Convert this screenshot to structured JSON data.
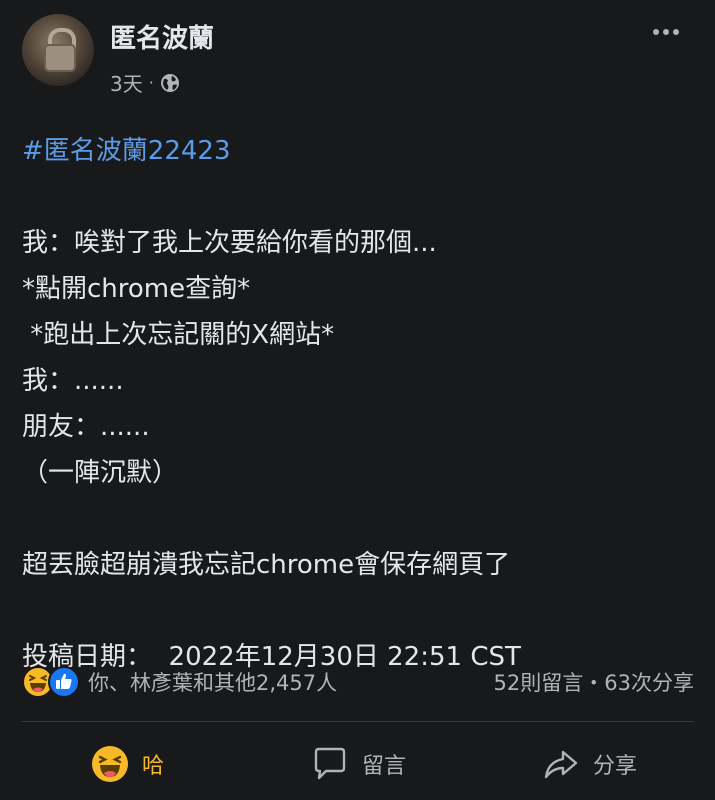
{
  "post": {
    "author": "匿名波蘭",
    "time": "3天",
    "separator": "·",
    "visibility_icon": "globe-icon",
    "more_icon": "more-horizontal-icon"
  },
  "content": {
    "hashtag": "#匿名波蘭22423",
    "lines": [
      "我：唉對了我上次要給你看的那個...",
      "*點開chrome查詢*",
      " *跑出上次忘記關的X網站*",
      "我：......",
      "朋友：......",
      "（一陣沉默）",
      "超丟臉超崩潰我忘記chrome會保存網頁了",
      "投稿日期：  2022年12月30日 22:51 CST"
    ]
  },
  "engagement": {
    "reaction_icons": [
      "haha-icon",
      "like-icon"
    ],
    "reactors": "你、林彥葉和其他2,457人",
    "comments_shares": "52則留言・63次分享"
  },
  "actions": {
    "haha_label": "哈",
    "comment_label": "留言",
    "share_label": "分享"
  },
  "colors": {
    "background": "#18191a",
    "text": "#e4e6eb",
    "secondary": "#b0b3b8",
    "hashtag": "#5b9be8",
    "haha": "#f7b928",
    "like": "#1877f2"
  }
}
